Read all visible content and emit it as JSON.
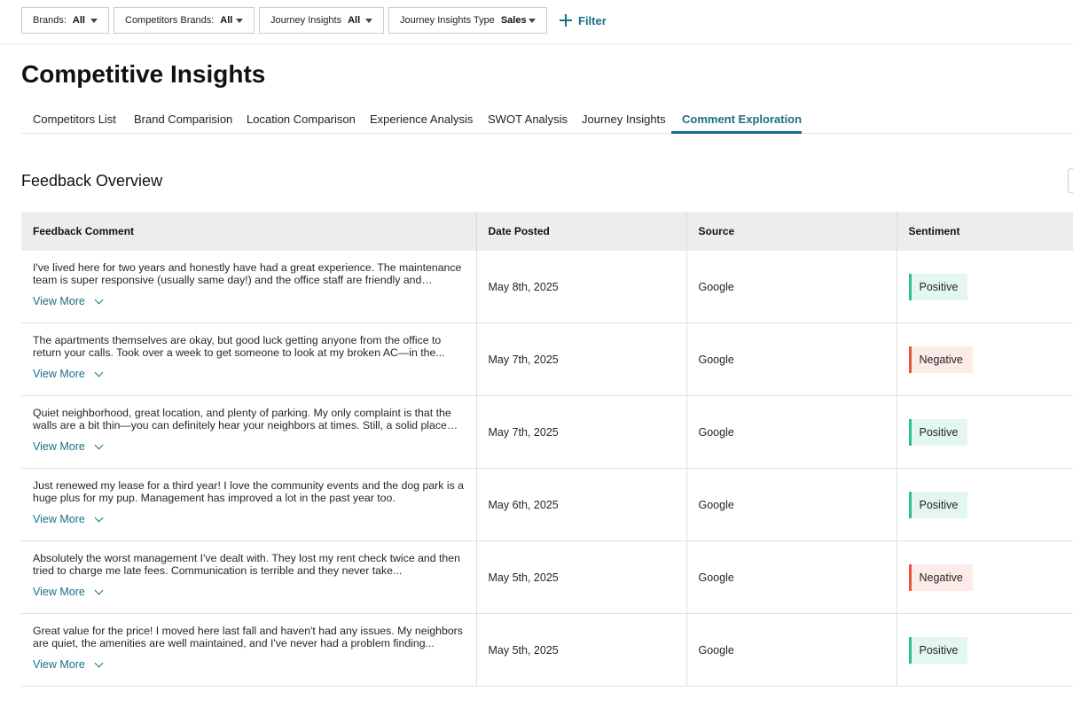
{
  "filters": [
    {
      "key": "Brands:",
      "value": "All"
    },
    {
      "key": "Competitors Brands:",
      "value": "All"
    },
    {
      "key": "Journey Insights",
      "value": "All"
    },
    {
      "key": "Journey Insights Type",
      "value": "Sales"
    }
  ],
  "add_filter_label": "Filter",
  "page_title": "Competitive Insights",
  "tabs": [
    {
      "label": "Competitors List"
    },
    {
      "label": "Brand Comparision"
    },
    {
      "label": "Location Comparison"
    },
    {
      "label": "Experience Analysis"
    },
    {
      "label": "SWOT Analysis"
    },
    {
      "label": "Journey Insights"
    },
    {
      "label": "Comment Exploration",
      "active": true
    }
  ],
  "section_title": "Feedback Overview",
  "table": {
    "headers": [
      "Feedback Comment",
      "Date Posted",
      "Source",
      "Sentiment"
    ],
    "view_more_label": "View More",
    "rows": [
      {
        "comment": "I've lived here for two years and honestly have had a great experience. The maintenance team is super responsive (usually same day!) and the office staff are friendly and helpful...",
        "date": "May 8th, 2025",
        "source": "Google",
        "sentiment": "Positive"
      },
      {
        "comment": "The apartments themselves are okay, but good luck getting anyone from the office to return your calls. Took over a week to get someone to look at my broken AC—in the...",
        "date": "May 7th, 2025",
        "source": "Google",
        "sentiment": "Negative"
      },
      {
        "comment": "Quiet neighborhood, great location, and plenty of parking. My only complaint is that the walls are a bit thin—you can definitely hear your neighbors at times. Still, a solid place to...",
        "date": "May 7th, 2025",
        "source": "Google",
        "sentiment": "Positive"
      },
      {
        "comment": "Just renewed my lease for a third year! I love the community events and the dog park is a huge plus for my pup. Management has improved a lot in the past year too.",
        "date": "May 6th, 2025",
        "source": "Google",
        "sentiment": "Positive"
      },
      {
        "comment": "Absolutely the worst management I've dealt with. They lost my rent check twice and then tried to charge me late fees. Communication is terrible and they never take...",
        "date": "May 5th, 2025",
        "source": "Google",
        "sentiment": "Negative"
      },
      {
        "comment": "Great value for the price! I moved here last fall and haven't had any issues. My neighbors are quiet, the amenities are well maintained, and I've never had a problem finding...",
        "date": "May 5th, 2025",
        "source": "Google",
        "sentiment": "Positive"
      }
    ]
  },
  "colors": {
    "accent": "#1a6f86",
    "positive": "#2fbf8a",
    "negative": "#e5543b"
  }
}
